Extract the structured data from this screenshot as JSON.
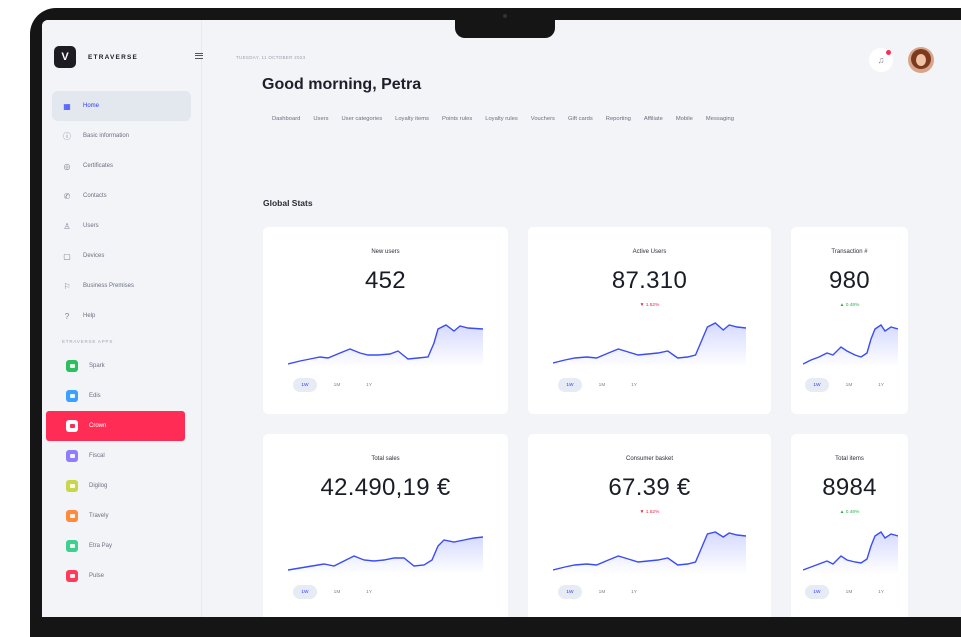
{
  "brand": {
    "name": "ETRAVERSE",
    "logo": "V"
  },
  "header": {
    "date": "TUESDAY, 11 OCTOBER 2023",
    "greeting": "Good morning, Petra"
  },
  "sidebar": {
    "items": [
      {
        "label": "Home",
        "icon": "grid-icon",
        "active": true
      },
      {
        "label": "Basic information",
        "icon": "info-icon"
      },
      {
        "label": "Certificates",
        "icon": "certificate-icon"
      },
      {
        "label": "Contacts",
        "icon": "phone-icon"
      },
      {
        "label": "Users",
        "icon": "user-icon"
      },
      {
        "label": "Devices",
        "icon": "device-icon"
      },
      {
        "label": "Business Premises",
        "icon": "flag-icon"
      },
      {
        "label": "Help",
        "icon": "help-icon"
      }
    ],
    "apps_heading": "ETRAVERSE APPS",
    "apps": [
      {
        "label": "Spark",
        "color": "#2dbf5f"
      },
      {
        "label": "Edis",
        "color": "#3ba0ff"
      },
      {
        "label": "Crown",
        "color": "#ff2d55",
        "active": true
      },
      {
        "label": "Fiscal",
        "color": "#8f7dff"
      },
      {
        "label": "Digilog",
        "color": "#c9d64a"
      },
      {
        "label": "Travely",
        "color": "#ff8a3d"
      },
      {
        "label": "Etra Pay",
        "color": "#3fcf8e"
      },
      {
        "label": "Pulse",
        "color": "#ff3b5c"
      }
    ]
  },
  "tabs": [
    "Dashboard",
    "Users",
    "User categories",
    "Loyalty items",
    "Points rules",
    "Loyalty rules",
    "Vouchers",
    "Gift cards",
    "Reporting",
    "Affiliate",
    "Mobile",
    "Messaging"
  ],
  "section_title": "Global Stats",
  "periods": [
    "1W",
    "1M",
    "1Y"
  ],
  "accent_color": "#2a3cff",
  "cards": [
    {
      "label": "New users",
      "value": "452",
      "delta": "",
      "delta_dir": ""
    },
    {
      "label": "Active Users",
      "value": "87.310",
      "delta": "▼ 1.52%",
      "delta_dir": "down"
    },
    {
      "label": "Transaction #",
      "value": "980",
      "delta": "▲ 0.48%",
      "delta_dir": "up"
    },
    {
      "label": "Total sales",
      "value": "42.490,19 €",
      "delta": "",
      "delta_dir": ""
    },
    {
      "label": "Consumer basket",
      "value": "67.39 €",
      "delta": "▼ 1.52%",
      "delta_dir": "down"
    },
    {
      "label": "Total items",
      "value": "8984",
      "delta": "▲ 0.48%",
      "delta_dir": "up"
    }
  ]
}
